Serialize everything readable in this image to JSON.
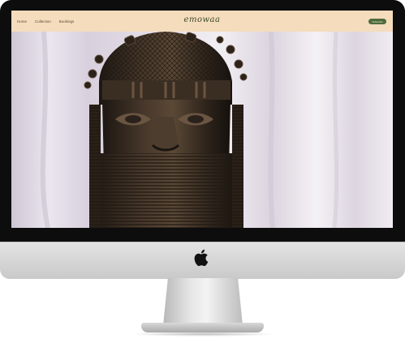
{
  "nav": {
    "items": [
      {
        "label": "Home"
      },
      {
        "label": "Collection"
      },
      {
        "label": "Bookings"
      }
    ]
  },
  "brand": {
    "logo_text": "emowaa"
  },
  "cta": {
    "label": "Subscribe"
  },
  "colors": {
    "header_bg": "#f4dcbc",
    "cta_bg": "#4f6a3c",
    "bezel": "#0d0d0d"
  },
  "icons": [
    "apple-logo-icon"
  ]
}
